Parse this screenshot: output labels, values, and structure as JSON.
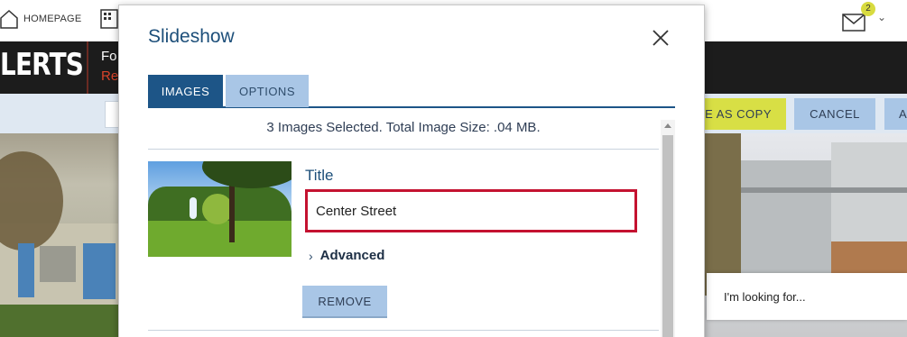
{
  "header": {
    "home_label": "HOMEPAGE",
    "mail_badge_count": "2"
  },
  "alert_bar": {
    "title": "LERTS",
    "line1": "Fo",
    "line2": "Re"
  },
  "action_bar": {
    "save_as_copy_label": "E AS COPY",
    "cancel_label": "CANCEL",
    "cut_label": "A"
  },
  "search_widget": {
    "placeholder": "I'm looking for..."
  },
  "modal": {
    "title": "Slideshow",
    "tabs": [
      {
        "label": "IMAGES",
        "active": true
      },
      {
        "label": "OPTIONS",
        "active": false
      }
    ],
    "summary": "3 Images Selected. Total Image Size: .04 MB.",
    "item": {
      "field_label": "Title",
      "title_value": "Center Street",
      "advanced_label": "Advanced",
      "remove_label": "REMOVE"
    }
  },
  "colors": {
    "accent": "#1d5587",
    "tab_inactive": "#a9c6e6",
    "highlight_border": "#c41230",
    "save_button": "#d8df45",
    "alert_bar_bg": "#1c1c1c",
    "alert_red": "#d9432a"
  },
  "icons": [
    "home-icon",
    "building-icon",
    "mail-icon",
    "chevron-down-icon",
    "close-icon",
    "chevron-right-icon",
    "scroll-up-icon"
  ]
}
